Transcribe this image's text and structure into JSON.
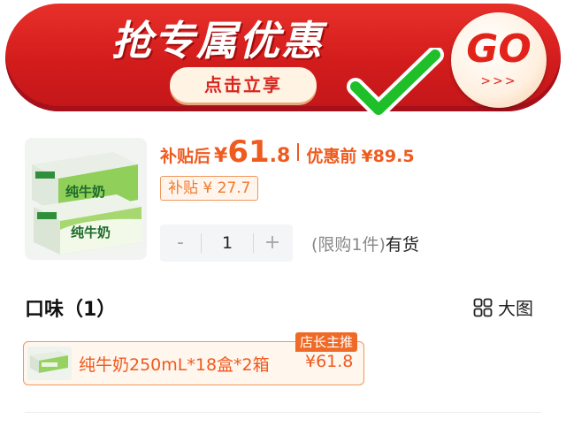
{
  "banner": {
    "title": "抢专属优惠",
    "subtitle": "点击立享",
    "go_label": "GO",
    "go_arrows": ">>>"
  },
  "product": {
    "price_after_label": "补贴后",
    "currency": "¥",
    "price_after_int": "61",
    "price_after_dec": ".8",
    "price_before_label": "优惠前",
    "price_before": "¥89.5",
    "subsidy_badge": "补贴 ¥ 27.7",
    "brand_text": "纯牛奶"
  },
  "quantity": {
    "minus": "-",
    "value": "1",
    "plus": "+",
    "limit_text": "(限购1件)",
    "stock_text": "有货"
  },
  "flavor": {
    "title": "口味（1）",
    "view_label": "大图",
    "variant": {
      "name": "纯牛奶250mL*18盒*2箱",
      "price": "¥61.8",
      "tag": "店长主推"
    }
  },
  "colors": {
    "accent": "#ef5a1e",
    "banner_red": "#d21c1c",
    "check_green": "#1fbf2a"
  }
}
